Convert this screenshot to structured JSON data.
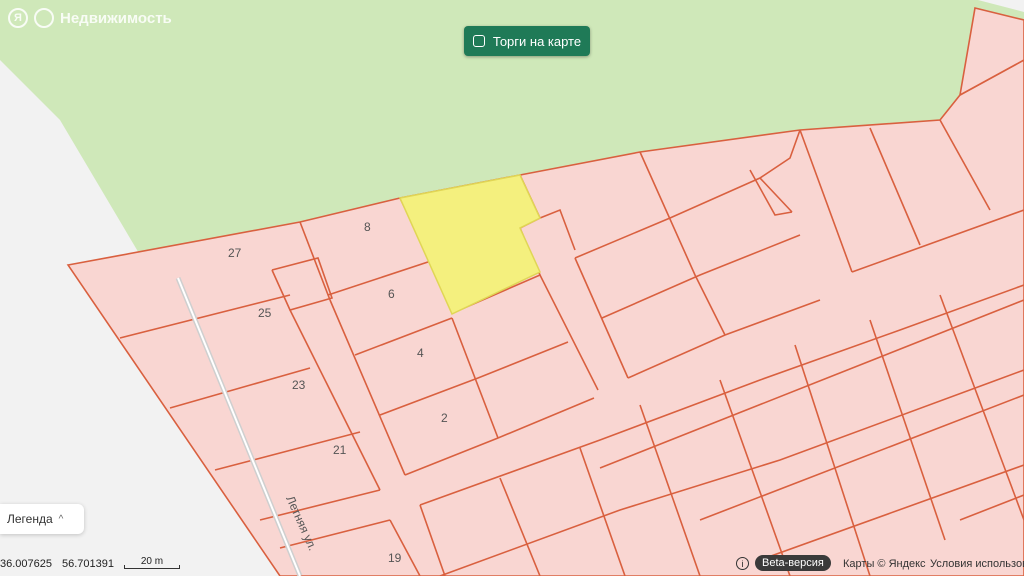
{
  "header": {
    "brand": "Недвижимость",
    "ya_letter": "Я"
  },
  "toolbar": {
    "torgi_label": "Торги на карте"
  },
  "map": {
    "labels": {
      "p27": "27",
      "p8": "8",
      "p6": "6",
      "p25": "25",
      "p4": "4",
      "p23": "23",
      "p2": "2",
      "p21": "21",
      "p19": "19"
    },
    "street_name": "Летняя ул.",
    "colors": {
      "forest": "#cfe8b9",
      "parcel": "#f9d6d2",
      "parcel_border": "#d9603f",
      "selected": "#f4f07e",
      "background": "#f2f2f2"
    }
  },
  "legend": {
    "label": "Легенда",
    "chevron": "^"
  },
  "footer": {
    "lon": "36.007625",
    "lat": "56.701391",
    "scale_label": "20 m",
    "info_icon": "i",
    "beta_label": "Beta-версия",
    "karty_label": "Карты © Яндекс",
    "terms_label": "Условия использов"
  }
}
